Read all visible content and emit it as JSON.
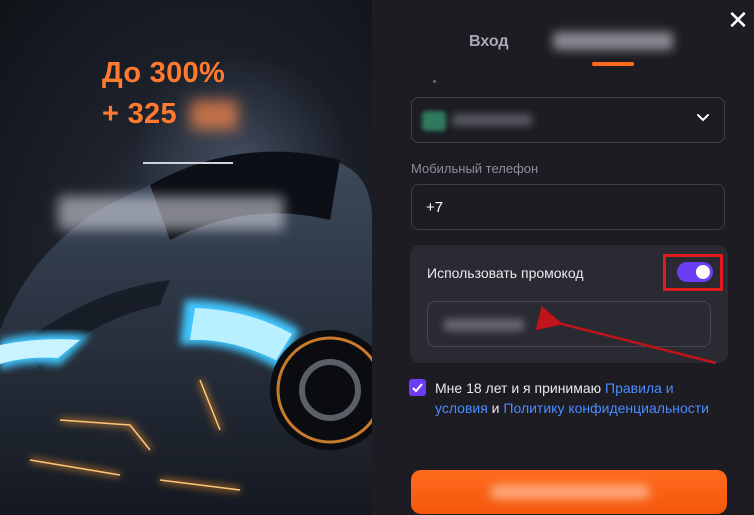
{
  "promo": {
    "headline": "До 300%",
    "bonus": "+ 325"
  },
  "auth": {
    "tab_login": "Вход",
    "phone_label": "Мобильный телефон",
    "phone_value": "+7",
    "promocode_label": "Использовать промокод",
    "promocode_toggle_on": true,
    "close_icon": "close-icon",
    "chevron_icon": "chevron-down-icon"
  },
  "terms": {
    "prefix": "Мне 18 лет и я принимаю ",
    "rules_link": "Правила и условия",
    "and": " и ",
    "privacy_link": "Политику конфиденциальности",
    "checked": true
  },
  "colors": {
    "accent_orange": "#ff6a1a",
    "toggle_purple": "#6a3df5",
    "link_blue": "#4a8cff",
    "highlight_red": "#e01b1b"
  }
}
